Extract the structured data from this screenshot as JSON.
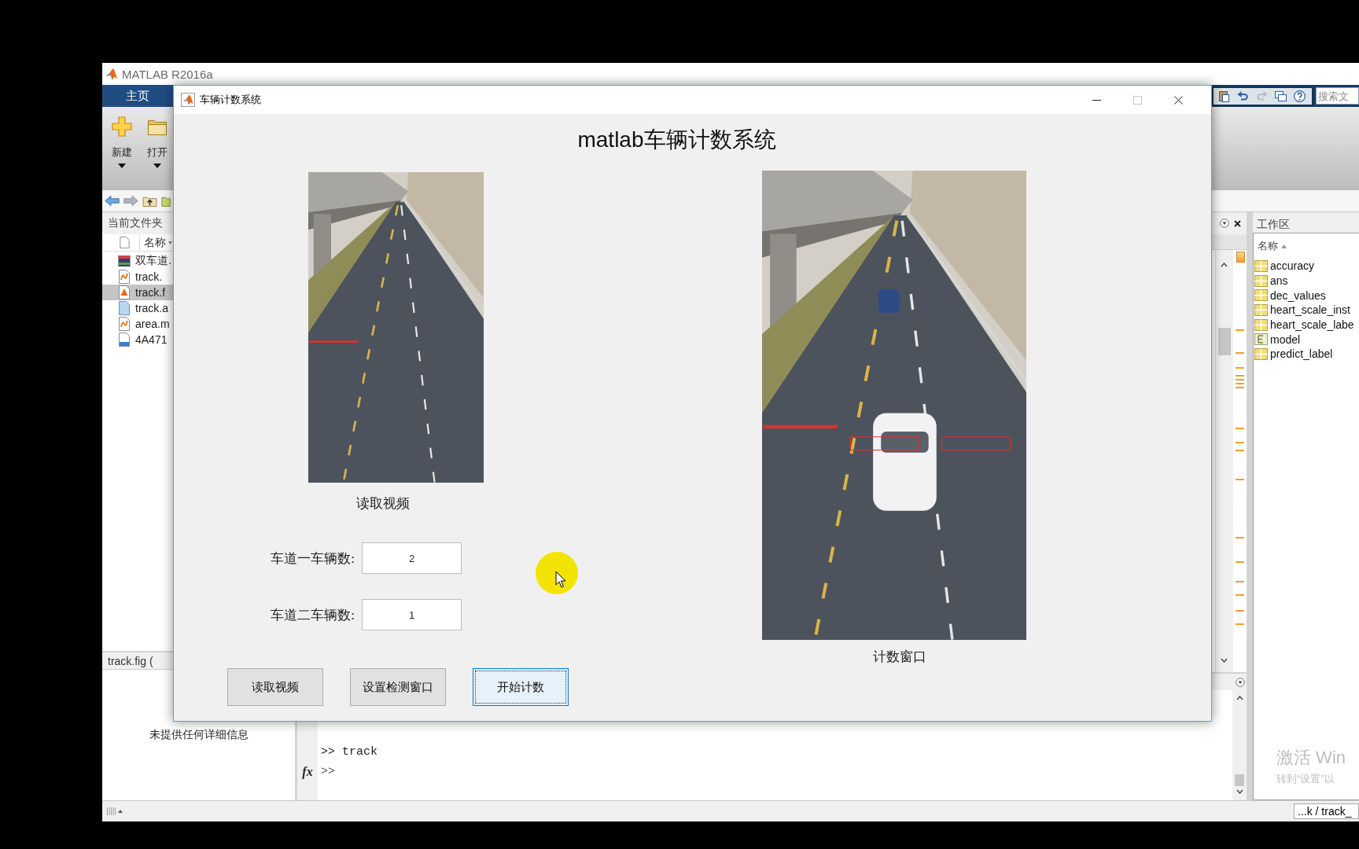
{
  "matlab": {
    "title": "MATLAB R2016a"
  },
  "toolstrip": {
    "tabs": [
      {
        "label": "主页",
        "selected": true
      }
    ],
    "buttons": [
      {
        "label": "新建",
        "kind": "new"
      },
      {
        "label": "打开",
        "kind": "open"
      }
    ],
    "quick_access": [
      {
        "kind": "paste",
        "disabled": false
      },
      {
        "kind": "undo",
        "disabled": false
      },
      {
        "kind": "redo",
        "disabled": true
      },
      {
        "kind": "windows",
        "disabled": false
      },
      {
        "kind": "help",
        "disabled": false
      }
    ],
    "search": {
      "placeholder": "搜索文"
    }
  },
  "current_folder": {
    "title": "当前文件夹",
    "column": "名称",
    "files": [
      {
        "name": "双车道.",
        "kind": "video",
        "selected": false
      },
      {
        "name": "track.",
        "kind": "script",
        "selected": false
      },
      {
        "name": "track.f",
        "kind": "figure",
        "selected": true
      },
      {
        "name": "track.a",
        "kind": "autosave",
        "selected": false
      },
      {
        "name": "area.m",
        "kind": "script",
        "selected": false
      },
      {
        "name": "4A471",
        "kind": "data",
        "selected": false
      }
    ]
  },
  "details": {
    "title": "track.fig (",
    "message": "未提供任何详细信息"
  },
  "command_window": {
    "history": [
      ">> track"
    ],
    "prompt": ">>",
    "function_icon": "fx"
  },
  "workspace": {
    "title": "工作区",
    "column": "名称",
    "variables": [
      {
        "name": "accuracy",
        "kind": "matrix"
      },
      {
        "name": "ans",
        "kind": "matrix"
      },
      {
        "name": "dec_values",
        "kind": "matrix"
      },
      {
        "name": "heart_scale_inst",
        "kind": "matrix"
      },
      {
        "name": "heart_scale_labe",
        "kind": "matrix"
      },
      {
        "name": "model",
        "kind": "struct"
      },
      {
        "name": "predict_label",
        "kind": "matrix"
      }
    ]
  },
  "activation_notice": {
    "title": "激活 Win",
    "subtitle": "转到“设置”以"
  },
  "status_bar": {
    "path": "...k / track_"
  },
  "dialog": {
    "title": "车辆计数系统",
    "window_controls": [
      {
        "kind": "minimize",
        "disabled": false
      },
      {
        "kind": "maximize",
        "disabled": true
      },
      {
        "kind": "close",
        "disabled": false
      }
    ],
    "heading": "matlab车辆计数系统",
    "video_panels": [
      {
        "kind": "input",
        "caption": "读取视频"
      },
      {
        "kind": "counting",
        "caption": "计数窗口"
      }
    ],
    "counts": [
      {
        "label": "车道一车辆数:",
        "value": "2"
      },
      {
        "label": "车道二车辆数:",
        "value": "1"
      }
    ],
    "buttons": [
      {
        "label": "读取视频",
        "focused": false
      },
      {
        "label": "设置检测窗口",
        "focused": false
      },
      {
        "label": "开始计数",
        "focused": true
      }
    ]
  }
}
